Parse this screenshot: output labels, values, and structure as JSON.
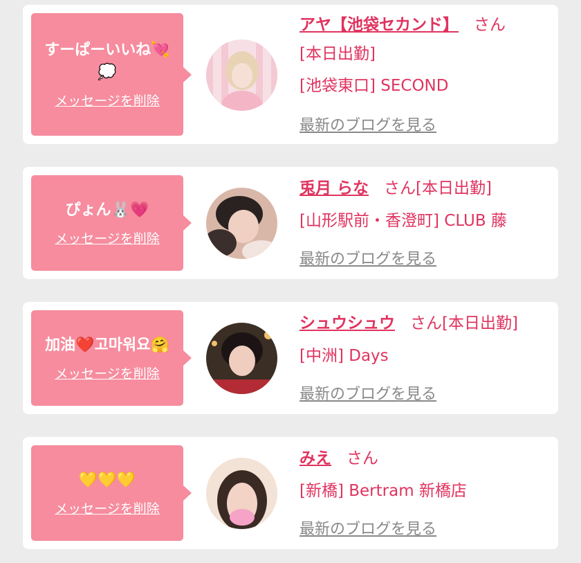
{
  "cards": [
    {
      "message": "すーぱーいいね💘\n💭",
      "delete_label": "メッセージを削除",
      "name": "アヤ【池袋セカンド】",
      "honorific": "さん",
      "lines": [
        "[本日出勤]",
        "[池袋東口] SECOND"
      ],
      "blog_label": "最新のブログを見る"
    },
    {
      "message": "ぴょん🐰💗",
      "delete_label": "メッセージを削除",
      "name": "兎月 らな",
      "honorific": "さん[本日出勤]",
      "lines": [
        "[山形駅前・香澄町] CLUB 藤"
      ],
      "blog_label": "最新のブログを見る"
    },
    {
      "message": "加油❤️고마워요🤗",
      "delete_label": "メッセージを削除",
      "name": "シュウシュウ",
      "honorific": "さん[本日出勤]",
      "lines": [
        "[中洲] Days"
      ],
      "blog_label": "最新のブログを見る"
    },
    {
      "message": "💛💛💛",
      "delete_label": "メッセージを削除",
      "name": "みえ",
      "honorific": "さん",
      "lines": [
        "[新橋] Bertram 新橋店"
      ],
      "blog_label": "最新のブログを見る"
    }
  ],
  "colors": {
    "accent": "#e0335f",
    "bubble": "#f68c9e",
    "background": "#ececec",
    "link_gray": "#888888"
  },
  "icons": [
    "heart-cupid-emoji",
    "thought-bubble-emoji",
    "rabbit-emoji",
    "heart-emoji",
    "hug-emoji",
    "yellow-heart-emoji"
  ]
}
